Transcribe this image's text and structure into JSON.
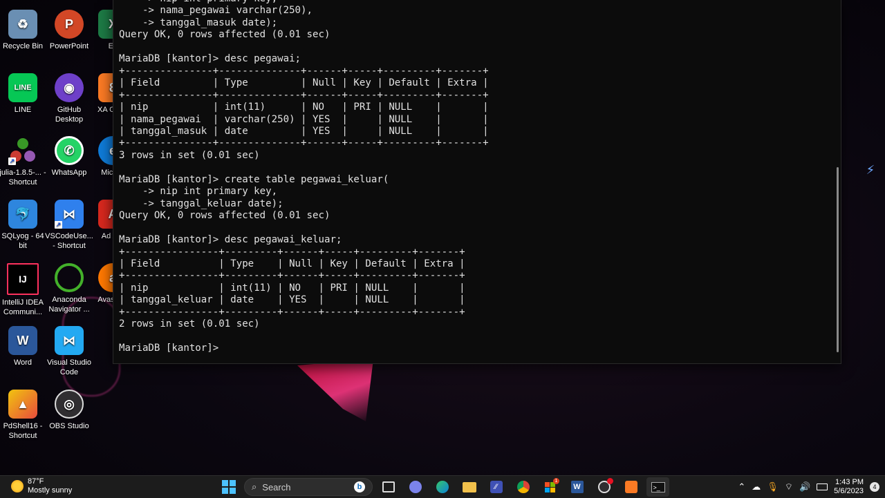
{
  "desktop": {
    "icons": [
      {
        "label": "Recycle Bin",
        "glyph": "♻",
        "color": "#5aa0d8"
      },
      {
        "label": "PowerPoint",
        "glyph": "P",
        "color": "#d24726"
      },
      {
        "label": "Ex",
        "glyph": "X",
        "color": "#1d7a45"
      },
      {
        "label": "LINE",
        "glyph": "LINE",
        "color": "#06c755"
      },
      {
        "label": "GitHub Desktop",
        "glyph": "◉",
        "color": "#6e40c9"
      },
      {
        "label": "XA Contr",
        "glyph": "8",
        "color": "#fb7a24"
      },
      {
        "label": "julia-1.8.5-... - Shortcut",
        "glyph": "●",
        "color": "#9558b2"
      },
      {
        "label": "WhatsApp",
        "glyph": "✆",
        "color": "#25d366"
      },
      {
        "label": "Mic Ed",
        "glyph": "e",
        "color": "#0f7bd8"
      },
      {
        "label": "SQLyog - 64 bit",
        "glyph": "🐬",
        "color": "#2e86de"
      },
      {
        "label": "VSCodeUse... - Shortcut",
        "glyph": "⋈",
        "color": "#2f80ed"
      },
      {
        "label": "Ad Acr",
        "glyph": "A",
        "color": "#d7281e"
      },
      {
        "label": "IntelliJ IDEA Communi...",
        "glyph": "IJ",
        "color": "#1b1b3a"
      },
      {
        "label": "Anaconda Navigator ...",
        "glyph": "○",
        "color": "#43b02a"
      },
      {
        "label": "Avas Ant",
        "glyph": "a",
        "color": "#ff7800"
      },
      {
        "label": "Word",
        "glyph": "W",
        "color": "#2b579a"
      },
      {
        "label": "Visual Studio Code",
        "glyph": "⋈",
        "color": "#23a9f2"
      },
      {
        "label": "PdShell16 - Shortcut",
        "glyph": "▲",
        "color": "#c0392b"
      },
      {
        "label": "OBS Studio",
        "glyph": "◎",
        "color": "#302e31"
      }
    ]
  },
  "terminal": {
    "lines": [
      "    -> nip int primary key,",
      "    -> nama_pegawai varchar(250),",
      "    -> tanggal_masuk date);",
      "Query OK, 0 rows affected (0.01 sec)",
      "",
      "MariaDB [kantor]> desc pegawai;",
      "+---------------+--------------+------+-----+---------+-------+",
      "| Field         | Type         | Null | Key | Default | Extra |",
      "+---------------+--------------+------+-----+---------+-------+",
      "| nip           | int(11)      | NO   | PRI | NULL    |       |",
      "| nama_pegawai  | varchar(250) | YES  |     | NULL    |       |",
      "| tanggal_masuk | date         | YES  |     | NULL    |       |",
      "+---------------+--------------+------+-----+---------+-------+",
      "3 rows in set (0.01 sec)",
      "",
      "MariaDB [kantor]> create table pegawai_keluar(",
      "    -> nip int primary key,",
      "    -> tanggal_keluar date);",
      "Query OK, 0 rows affected (0.01 sec)",
      "",
      "MariaDB [kantor]> desc pegawai_keluar;",
      "+----------------+---------+------+-----+---------+-------+",
      "| Field          | Type    | Null | Key | Default | Extra |",
      "+----------------+---------+------+-----+---------+-------+",
      "| nip            | int(11) | NO   | PRI | NULL    |       |",
      "| tanggal_keluar | date    | YES  |     | NULL    |       |",
      "+----------------+---------+------+-----+---------+-------+",
      "2 rows in set (0.01 sec)",
      "",
      "MariaDB [kantor]> "
    ]
  },
  "taskbar": {
    "weather_temp": "87°F",
    "weather_desc": "Mostly sunny",
    "search_placeholder": "Search",
    "time": "1:43 PM",
    "date": "5/6/2023",
    "notification_count": "4",
    "teams_badge": "1"
  },
  "colors": {
    "terminal_bg": "#0c0c0c",
    "terminal_fg": "#e2e2e2",
    "taskbar_bg": "#1c1c1c",
    "windows_accent": "#4cc2ff"
  }
}
